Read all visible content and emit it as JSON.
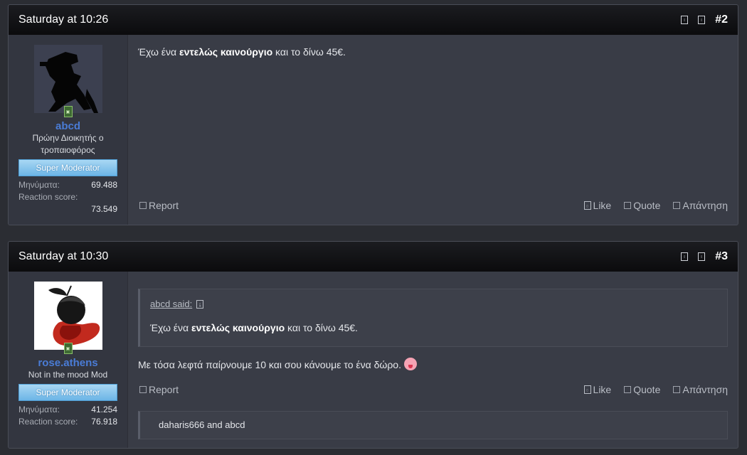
{
  "posts": [
    {
      "date": "Saturday at 10:26",
      "number": "#2",
      "user": {
        "name": "abcd",
        "title": "Πρώην Διοικητής ο τροπαιοφόρος",
        "banner": "Super Moderator",
        "messages_label": "Μηνύματα:",
        "messages_value": "69.488",
        "reaction_label": "Reaction score:",
        "reaction_value": "73.549"
      },
      "message": {
        "pre": "Έχω ένα ",
        "bold": "εντελώς καινούργιο",
        "post": " και το δίνω 45€."
      },
      "actions": {
        "report": "Report",
        "like": "Like",
        "quote": "Quote",
        "reply": "Απάντηση"
      }
    },
    {
      "date": "Saturday at 10:30",
      "number": "#3",
      "user": {
        "name": "rose.athens",
        "title": "Not in the mood Mod",
        "banner": "Super Moderator",
        "messages_label": "Μηνύματα:",
        "messages_value": "41.254",
        "reaction_label": "Reaction score:",
        "reaction_value": "76.918"
      },
      "quote": {
        "author": "abcd said:",
        "pre": "Έχω ένα ",
        "bold": "εντελώς καινούργιο",
        "post": " και το δίνω 45€."
      },
      "message": {
        "text": "Με τόσα λεφτά παίρνουμε 10 και σου κάνουμε το ένα δώρο. "
      },
      "actions": {
        "report": "Report",
        "like": "Like",
        "quote": "Quote",
        "reply": "Απάντηση"
      },
      "reactions": "daharis666 and abcd"
    }
  ],
  "icons": {
    "bookmark": "bookmark-icon",
    "share": "share-icon",
    "online": "online-status-icon",
    "emoji": "tongue-out-emoji-icon"
  },
  "colors": {
    "page_bg": "#2b2d33",
    "post_bg": "#393c46",
    "username": "#4a7cd6",
    "banner": "#8cc8f0"
  }
}
